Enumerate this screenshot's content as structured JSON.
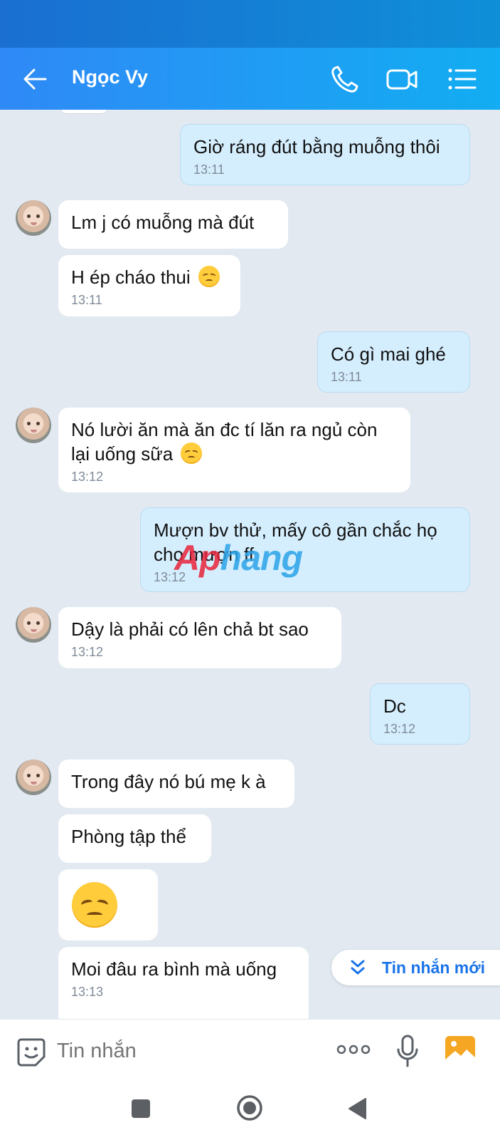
{
  "header": {
    "contact_name": "Ngọc Vy"
  },
  "messages": [
    {
      "dir": "out",
      "text": "Giờ ráng đút bằng muỗng thôi",
      "time": "13:11"
    },
    {
      "dir": "in",
      "text": "Lm j có muỗng mà đút",
      "time": ""
    },
    {
      "dir": "in",
      "text": "H ép cháo thui",
      "time": "13:11",
      "emoji": "disappointed-face"
    },
    {
      "dir": "out",
      "text": "Có gì mai ghé",
      "time": "13:11"
    },
    {
      "dir": "in",
      "text_line1": "Nó lười ăn mà ăn đc tí lăn ra ngủ còn",
      "text_line2": "lại uống sữa",
      "time": "13:12",
      "emoji": "disappointed-face"
    },
    {
      "dir": "out",
      "text_line1": "Mượn bv thử, mấy cô gần chắc họ",
      "text_line2": "cho mượn ff",
      "time": "13:12"
    },
    {
      "dir": "in",
      "text": "Dậy là phải có lên chả bt sao",
      "time": "13:12"
    },
    {
      "dir": "out",
      "text": "Dc",
      "time": "13:12"
    },
    {
      "dir": "in",
      "text": "Trong đây nó bú mẹ k à",
      "time": ""
    },
    {
      "dir": "in",
      "text": "Phòng tập thể",
      "time": ""
    },
    {
      "dir": "in",
      "emoji": "disappointed-face",
      "time": ""
    },
    {
      "dir": "in",
      "text": "Moi đâu ra bình mà uống",
      "time": "13:13"
    }
  ],
  "watermark": {
    "part1": "Ap",
    "part2": "hang"
  },
  "new_messages_button": {
    "label": "Tin nhắn mới"
  },
  "composer": {
    "placeholder": "Tin nhắn"
  },
  "colors": {
    "header_start": "#2f89f6",
    "header_end": "#12adf2",
    "outgoing_bubble": "#d5eefe",
    "incoming_bubble": "#ffffff",
    "chat_bg": "#e2e9f1"
  }
}
